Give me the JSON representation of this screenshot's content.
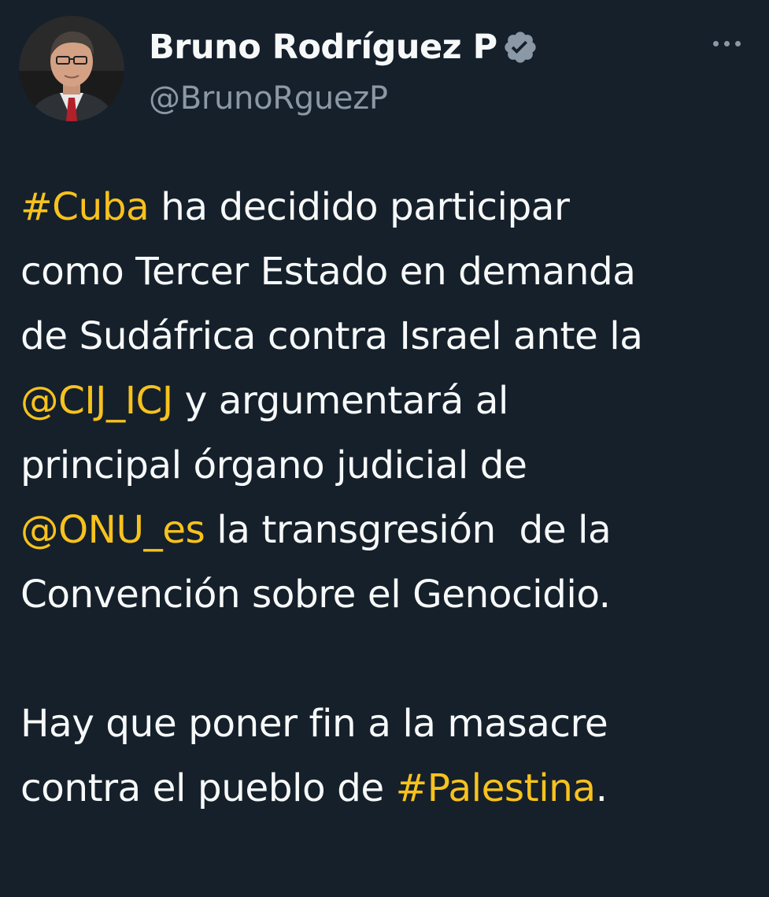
{
  "author": {
    "display_name": "Bruno Rodríguez P",
    "handle": "@BrunoRguezP",
    "verified": true
  },
  "icons": {
    "avatar": "profile-photo",
    "verified": "verified-badge-icon",
    "more": "more-options-icon"
  },
  "colors": {
    "background": "#15202b",
    "text": "#f7f9f9",
    "secondary_text": "#8b98a5",
    "link": "#f7c21d",
    "badge": "#8b98a5"
  },
  "tweet": {
    "lines": [
      [
        {
          "text": "#Cuba",
          "link": true
        },
        {
          "text": " ha decidido participar"
        }
      ],
      [
        {
          "text": "como Tercer Estado en demanda"
        }
      ],
      [
        {
          "text": "de Sudáfrica contra Israel ante la"
        }
      ],
      [
        {
          "text": "@CIJ_ICJ",
          "link": true
        },
        {
          "text": " y argumentará al"
        }
      ],
      [
        {
          "text": "principal órgano judicial de"
        }
      ],
      [
        {
          "text": "@ONU_es",
          "link": true
        },
        {
          "text": " la transgresión  de la"
        }
      ],
      [
        {
          "text": "Convención sobre el Genocidio."
        }
      ],
      [],
      [
        {
          "text": "Hay que poner fin a la masacre"
        }
      ],
      [
        {
          "text": "contra el pueblo de "
        },
        {
          "text": "#Palestina",
          "link": true
        },
        {
          "text": "."
        }
      ]
    ]
  }
}
